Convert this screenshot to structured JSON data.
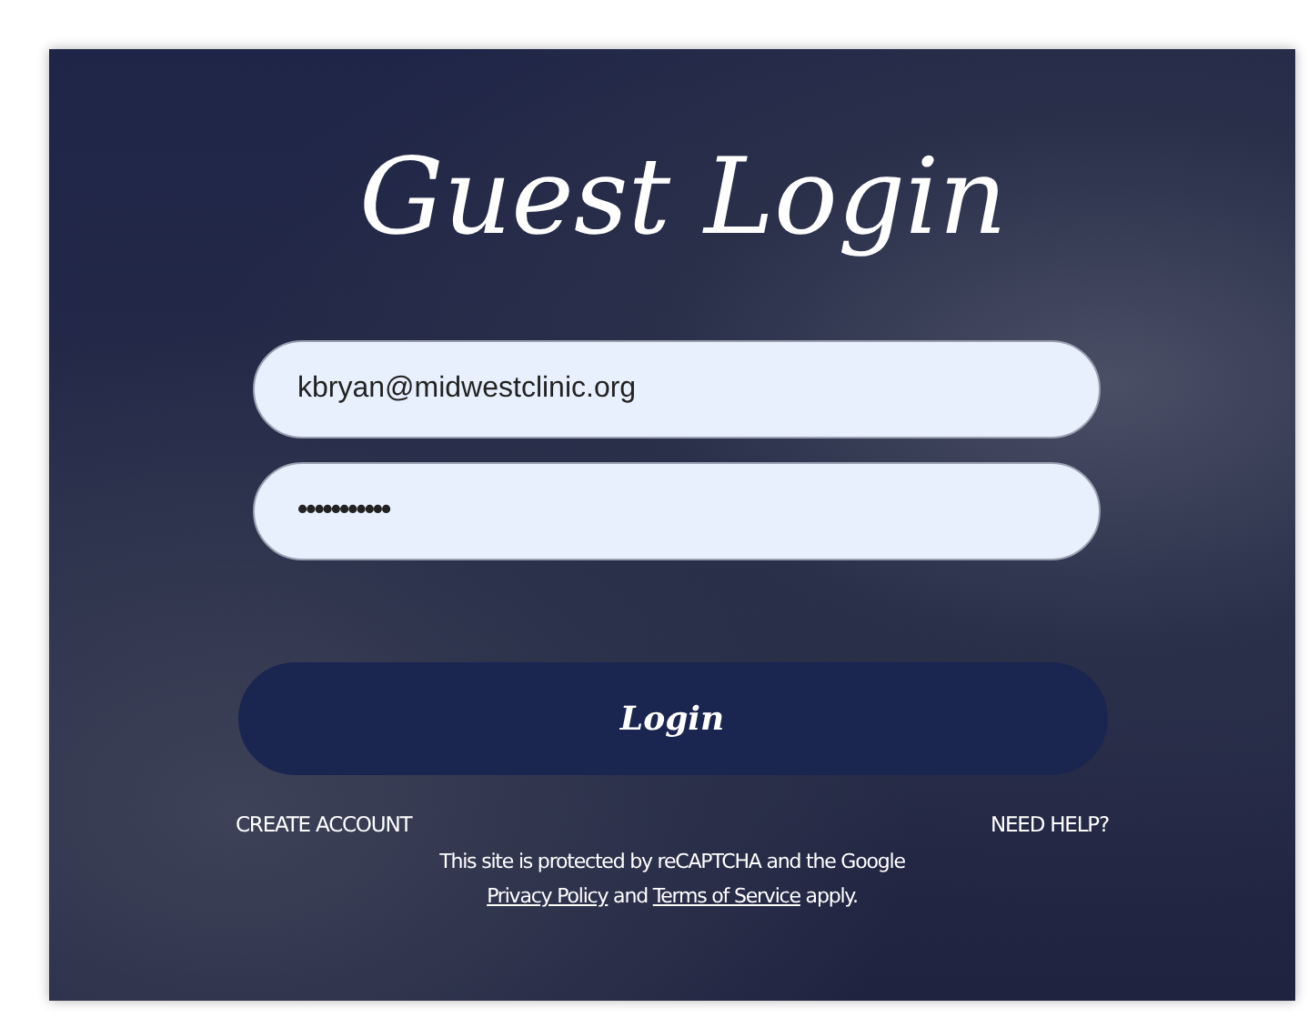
{
  "title": "Guest Login",
  "email_field": {
    "value": "kbryan@midwestclinic.org"
  },
  "password_field": {
    "value": "•••••••••••"
  },
  "login_button": {
    "label": "Login"
  },
  "links": {
    "create_account": "CREATE ACCOUNT",
    "need_help": "NEED HELP?"
  },
  "recaptcha_notice": {
    "text": "This site is protected by reCAPTCHA and the Google",
    "privacy_link": "Privacy Policy",
    "joiner": "and",
    "terms_link": "Terms of Service",
    "ending": "apply."
  }
}
